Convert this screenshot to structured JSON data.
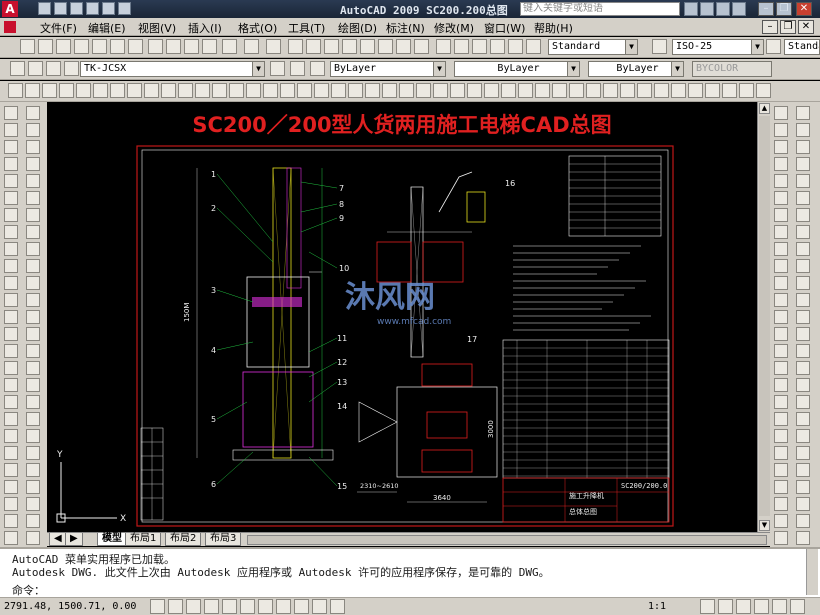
{
  "window": {
    "title": "AutoCAD 2009  SC200.200总图",
    "search_placeholder": "键入关键字或短语"
  },
  "menu": [
    "文件(F)",
    "编辑(E)",
    "视图(V)",
    "插入(I)",
    "格式(O)",
    "工具(T)",
    "绘图(D)",
    "标注(N)",
    "修改(M)",
    "窗口(W)",
    "帮助(H)"
  ],
  "toolbar": {
    "text_style": "Standard",
    "dim_style": "ISO-25",
    "table_style": "Standar",
    "layer": "TK-JCSX",
    "color": "ByLayer",
    "linetype": "ByLayer",
    "lineweight": "ByLayer",
    "plotstyle": "BYCOLOR"
  },
  "drawing": {
    "title": "SC200／200型人货两用施工电梯CAD总图",
    "watermark": "沐风网",
    "watermark_url": "www.mfcad.com",
    "dims": [
      "150M",
      "2310~2610",
      "3640",
      "3000"
    ],
    "callouts": [
      "1",
      "2",
      "3",
      "4",
      "5",
      "6",
      "7",
      "8",
      "9",
      "10",
      "11",
      "12",
      "13",
      "14",
      "15",
      "16",
      "17"
    ],
    "title_block_name": "SC200/200.0",
    "title_block_label": "施工升降机",
    "title_block_sub": "总体总图"
  },
  "tabs": [
    "模型",
    "布局1",
    "布局2",
    "布局3"
  ],
  "command": {
    "line1": "AutoCAD 菜单实用程序已加载。",
    "line2": "Autodesk DWG.   此文件上次由 Autodesk 应用程序或 Autodesk 许可的应用程序保存，是可靠的 DWG。",
    "prompt": "命令："
  },
  "status": {
    "coords": "2791.48, 1500.71, 0.00",
    "scale": "1:1"
  },
  "colors": {
    "title_red": "#e02020",
    "frame_red": "#c01818",
    "draw_white": "#f0f0f0",
    "draw_green": "#20c040",
    "draw_magenta": "#e030e0",
    "draw_yellow": "#e8e020"
  }
}
